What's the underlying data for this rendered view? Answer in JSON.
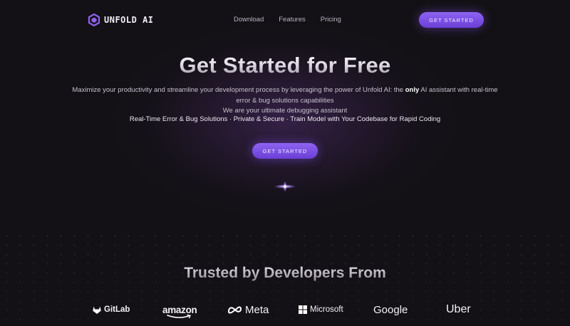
{
  "nav": {
    "brand": "UNFOLD AI",
    "links": [
      "Download",
      "Features",
      "Pricing"
    ],
    "cta": "GET STARTED"
  },
  "hero": {
    "title": "Get Started for Free",
    "subtitle_pre": "Maximize your productivity and streamline your development process by leveraging the power of Unfold AI: the ",
    "subtitle_bold": "only",
    "subtitle_post": " AI assistant with real-time error & bug solutions capabilities",
    "tagline": "We are your ultimate debugging assistant",
    "features": "Real-Time Error & Bug Solutions · Private & Secure · Train Model with Your Codebase for Rapid Coding",
    "cta": "GET STARTED"
  },
  "trusted": {
    "heading": "Trusted by Developers From",
    "logos": [
      {
        "name": "GitLab",
        "icon": "gitlab-fox-icon"
      },
      {
        "name": "amazon",
        "icon": "amazon-smile-icon"
      },
      {
        "name": "Meta",
        "icon": "meta-infinity-icon"
      },
      {
        "name": "Microsoft",
        "icon": "microsoft-grid-icon"
      },
      {
        "name": "Google",
        "icon": null
      },
      {
        "name": "Uber",
        "icon": null
      }
    ]
  },
  "colors": {
    "background": "#131115",
    "accent": "#7b4fe4",
    "glow": "#5c3280"
  }
}
